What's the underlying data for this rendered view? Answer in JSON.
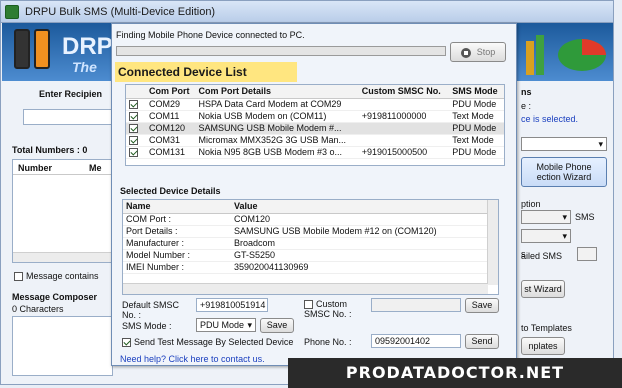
{
  "app": {
    "title": "DRPU Bulk SMS (Multi-Device Edition)"
  },
  "banner": {
    "brand": "DRPU",
    "tagline": "The"
  },
  "left": {
    "enter_recipient": "Enter Recipien",
    "total_numbers": "Total Numbers : 0",
    "col_number": "Number",
    "col_message": "Me",
    "message_contains": "Message contains",
    "composer": "Message Composer",
    "characters": "0 Characters"
  },
  "right": {
    "ns": "ns",
    "colon": "e :",
    "selected": "ce is selected.",
    "mobile_phone": "Mobile Phone",
    "wizard": "ection  Wizard",
    "option": "ption",
    "sms": "SMS",
    "s": "s",
    "failed_sms": "ailed SMS",
    "st_wizard": "st Wizard",
    "to_templates": "to Templates",
    "templates": "nplates"
  },
  "dialog": {
    "status": "Finding Mobile Phone Device connected to PC.",
    "progress": 0,
    "stop_label": "Stop",
    "connected_title": "Connected Device List",
    "connected_cols": [
      "Com Port",
      "Com Port Details",
      "Custom SMSC No.",
      "SMS Mode"
    ],
    "devices": [
      {
        "port": "COM29",
        "details": "HSPA Data Card Modem at COM29",
        "smsc": "",
        "mode": "PDU Mode"
      },
      {
        "port": "COM11",
        "details": "Nokia USB Modem on (COM11)",
        "smsc": "+919811000000",
        "mode": "Text Mode"
      },
      {
        "port": "COM120",
        "details": "SAMSUNG USB Mobile Modem #...",
        "smsc": "",
        "mode": "PDU Mode"
      },
      {
        "port": "COM31",
        "details": "Micromax MMX352G 3G USB Man...",
        "smsc": "",
        "mode": "Text Mode"
      },
      {
        "port": "COM131",
        "details": "Nokia N95 8GB USB Modem #3 o...",
        "smsc": "+919015000500",
        "mode": "PDU Mode"
      }
    ],
    "selected_title": "Selected Device Details",
    "details_cols": [
      "Name",
      "Value"
    ],
    "details": [
      {
        "name": "COM Port :",
        "value": "COM120"
      },
      {
        "name": "Port Details :",
        "value": "SAMSUNG USB Mobile Modem #12 on (COM120)"
      },
      {
        "name": "Manufacturer :",
        "value": "Broadcom"
      },
      {
        "name": "Model Number :",
        "value": "GT-S5250"
      },
      {
        "name": "IMEI Number :",
        "value": "359020041130969"
      }
    ],
    "default_smsc_label": "Default SMSC No. :",
    "default_smsc_value": "+919810051914",
    "custom_smsc_label": "Custom SMSC No. :",
    "custom_smsc_value": "",
    "save_label": "Save",
    "sms_mode_label": "SMS Mode :",
    "sms_mode_value": "PDU Mode",
    "send_test_label": "Send Test Message By Selected Device",
    "phone_no_label": "Phone No. :",
    "phone_no_value": "09592001402",
    "send_label": "Send",
    "help_link": "Need help? Click here to contact us."
  },
  "watermark": "PRODATADOCTOR.NET",
  "colors": {
    "accent": "#1c5a9c",
    "highlight": "#ffe680",
    "link": "#1a3fbf"
  }
}
